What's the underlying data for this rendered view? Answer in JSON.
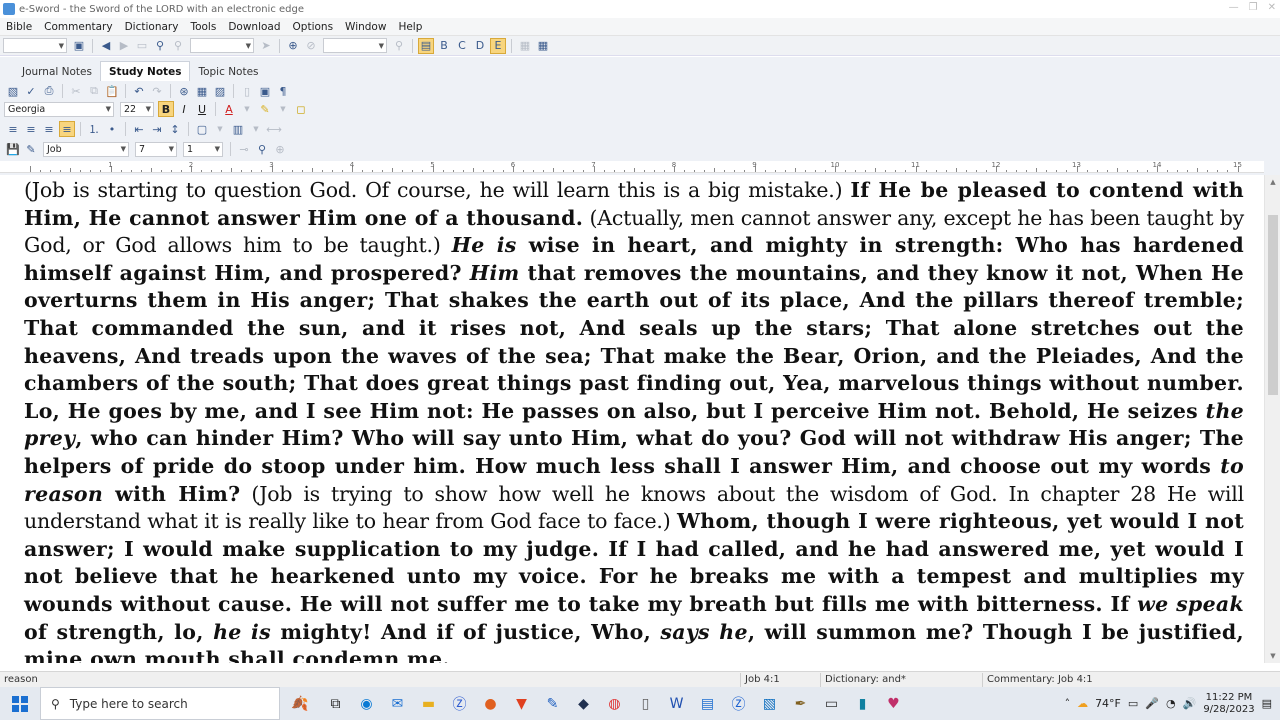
{
  "window": {
    "title": "e-Sword - the Sword of the LORD with an electronic edge"
  },
  "menu": [
    "Bible",
    "Commentary",
    "Dictionary",
    "Tools",
    "Download",
    "Options",
    "Window",
    "Help"
  ],
  "notes": {
    "tabs": [
      "Journal Notes",
      "Study Notes",
      "Topic Notes"
    ],
    "active_tab": "Study Notes",
    "font_name": "Georgia",
    "font_size": "22",
    "book": "Job",
    "chapter": "7",
    "verse": "1"
  },
  "ruler_numbers": [
    "1",
    "2",
    "3",
    "4",
    "5",
    "6",
    "7",
    "8",
    "9",
    "10",
    "11",
    "12",
    "13",
    "14",
    "15"
  ],
  "document": {
    "paragraph": [
      {
        "t": "(Job is starting to question God.  Of course, he will learn this is a big mistake.)  ",
        "s": "n"
      },
      {
        "t": "If He be pleased to contend with Him, He cannot answer Him one of a thousand.",
        "s": "b"
      },
      {
        "t": " (Actually, men cannot answer any, except he has been taught by God, or God allows him to be taught.)  ",
        "s": "n"
      },
      {
        "t": "He is",
        "s": "bi"
      },
      {
        "t": " wise in heart, and mighty in strength: Who has hardened himself against Him, and prospered?  ",
        "s": "b"
      },
      {
        "t": "Him",
        "s": "bi"
      },
      {
        "t": " that removes the mountains, and they know it not, When He overturns them in His anger;  That shakes the earth out of its place, And the pillars thereof tremble;  That commanded the sun, and it rises not, And seals up the stars;  That alone stretches out the heavens, And treads upon the waves of the sea;  That make the Bear, Orion, and the Pleiades, And the chambers of the south;  That does great things past finding out, Yea, marvelous things without number.  Lo, He goes by me, and I see Him not: He passes on also, but I perceive Him not.  Behold, He seizes ",
        "s": "b"
      },
      {
        "t": "the prey",
        "s": "bi"
      },
      {
        "t": ", who can hinder Him? Who will say unto Him, what do you?  God will not withdraw His anger; The helpers of pride do stoop under him.  How much less shall I answer Him, and choose out my words ",
        "s": "b"
      },
      {
        "t": "to reason",
        "s": "bi"
      },
      {
        "t": " with Him?",
        "s": "b"
      },
      {
        "t": " (Job is trying to show how well he knows about the wisdom of God.  In chapter 28 He will understand what it is really like to hear from God face to face.)  ",
        "s": "n"
      },
      {
        "t": "Whom, though I were righteous, yet would I not answer; I would make supplication to my judge.  If I had called, and he had answered me, yet would I not believe that he hearkened unto my voice.  For he breaks me with a tempest and multiplies my wounds without cause.  He will not suffer me to take my breath but fills me with bitterness.  If ",
        "s": "b"
      },
      {
        "t": "we speak",
        "s": "bi"
      },
      {
        "t": " of strength, lo, ",
        "s": "b"
      },
      {
        "t": "he is",
        "s": "bi"
      },
      {
        "t": " mighty! And if of justice, Who, ",
        "s": "b"
      },
      {
        "t": "says he",
        "s": "bi"
      },
      {
        "t": ", will summon me?  Though I be justified, mine own mouth shall condemn me.",
        "s": "b"
      }
    ]
  },
  "status": {
    "left": "reason",
    "bible": "Job 4:1",
    "dictionary": "Dictionary: and*",
    "commentary": "Commentary: Job 4:1"
  },
  "taskbar": {
    "search_placeholder": "Type here to search",
    "weather": "74°F",
    "time": "11:22 PM",
    "date": "9/28/2023"
  }
}
